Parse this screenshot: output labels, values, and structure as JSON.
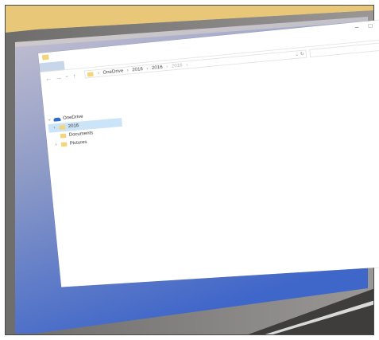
{
  "colors": {
    "folder": "#f3d57a",
    "selection": "#cce4f7",
    "onedrive": "#2e6fc4",
    "desk_top": "#e9c779",
    "screen_blue": "#4f78d2"
  },
  "titlebar": {
    "icon": "folder-icon",
    "minimize": "–",
    "maximize": "□",
    "close": "×"
  },
  "nav": {
    "back": "←",
    "forward": "→",
    "dropdown": "⌄",
    "up": "↑"
  },
  "address_bar": {
    "crumbs": [
      "OneDrive",
      "2016",
      "2016",
      "2016"
    ],
    "separator": "›",
    "dropdown": "⌄",
    "refresh": "↻"
  },
  "search": {
    "icon": "search-icon",
    "glyph": "⌕"
  },
  "nav_pane": {
    "items": [
      {
        "label": "OneDrive",
        "icon": "onedrive-cloud-icon",
        "expanded": true
      },
      {
        "label": "2016",
        "icon": "folder-icon",
        "selected": true
      },
      {
        "label": "Documents",
        "icon": "folder-icon"
      },
      {
        "label": "Pictures",
        "icon": "folder-icon"
      }
    ],
    "chevron_down": "⌄",
    "chevron_right": "›"
  }
}
